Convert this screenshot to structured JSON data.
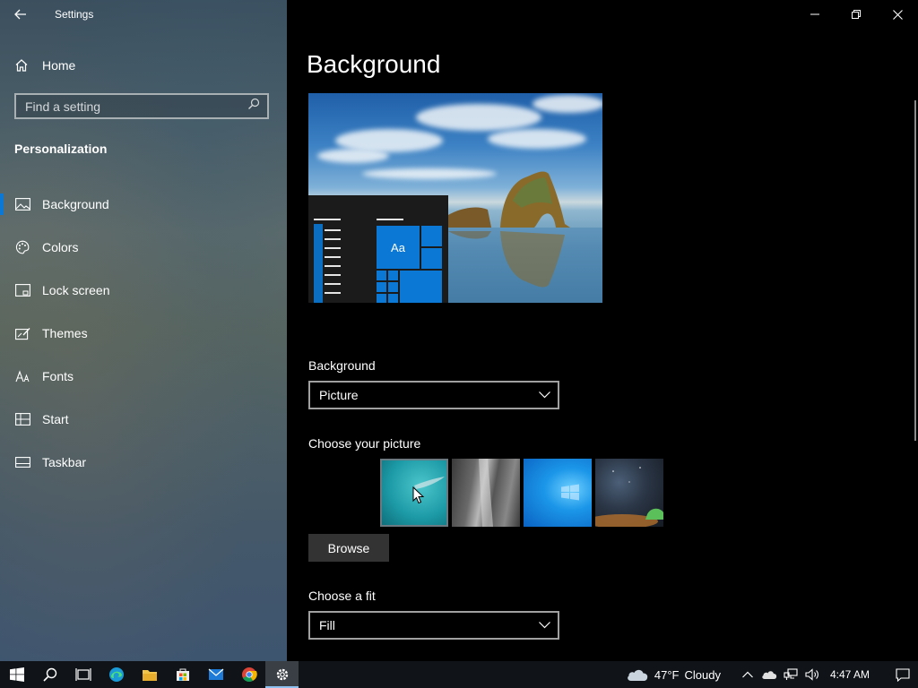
{
  "window": {
    "app_title": "Settings"
  },
  "sidebar": {
    "home_label": "Home",
    "search_placeholder": "Find a setting",
    "section_title": "Personalization",
    "items": [
      {
        "label": "Background",
        "icon": "picture-icon",
        "selected": true
      },
      {
        "label": "Colors",
        "icon": "palette-icon",
        "selected": false
      },
      {
        "label": "Lock screen",
        "icon": "lock-screen-icon",
        "selected": false
      },
      {
        "label": "Themes",
        "icon": "themes-icon",
        "selected": false
      },
      {
        "label": "Fonts",
        "icon": "fonts-icon",
        "selected": false
      },
      {
        "label": "Start",
        "icon": "start-icon",
        "selected": false
      },
      {
        "label": "Taskbar",
        "icon": "taskbar-icon",
        "selected": false
      }
    ]
  },
  "main": {
    "title": "Background",
    "preview_sample_text": "Aa",
    "background_label": "Background",
    "background_value": "Picture",
    "choose_picture_label": "Choose your picture",
    "browse_label": "Browse",
    "fit_label": "Choose a fit",
    "fit_value": "Fill",
    "pictures": [
      "ocean-swimmer",
      "waterfall",
      "windows-blue",
      "night-sky-tent"
    ]
  },
  "taskbar": {
    "apps": [
      "start-icon",
      "search-icon",
      "task-view-icon",
      "edge-icon",
      "file-explorer-icon",
      "store-icon",
      "mail-icon",
      "chrome-icon",
      "settings-icon"
    ],
    "active_app": "settings-icon",
    "weather_temp": "47°F",
    "weather_desc": "Cloudy",
    "time": "4:47 AM"
  },
  "colors": {
    "accent": "#0a78d4",
    "main_bg": "#000000",
    "taskbar_bg": "#101418"
  }
}
